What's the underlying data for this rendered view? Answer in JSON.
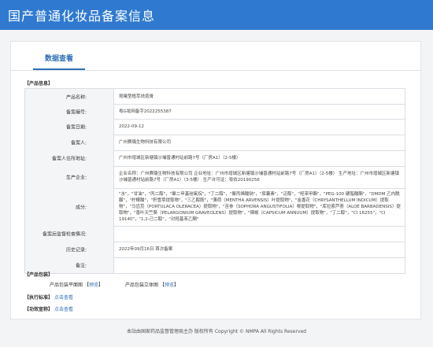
{
  "header": {
    "title": "国产普通化妆品备案信息"
  },
  "tabs": [
    {
      "label": "数据查看"
    }
  ],
  "product_info": {
    "section_title": "【产品信息】",
    "rows": [
      {
        "label": "产品名称:",
        "value": "昆曦莹植萃祛痘膏"
      },
      {
        "label": "备案编号:",
        "value": "粤G妆网备字2022255387"
      },
      {
        "label": "备案日期:",
        "value": "2022-09-12"
      },
      {
        "label": "备案人:",
        "value": "广州赛璐生物科技有限公司"
      },
      {
        "label": "备案人住所地址:",
        "value": "广州市增城区新塘镇沙埔普通村站前路7号（厂房A1）（2-5楼）"
      },
      {
        "label": "生产企业:",
        "value": "企业名称：广州赛璐生物科技有限公司 企业地址：广州市增城区新塘镇沙埔普通村站前路7号（厂房A1）（2-5楼） 生产地址：广州市增城区新塘镇沙埔普通村站前路7号（厂房A1）（3-5楼） 生产许可证：粤妆20190256"
      },
      {
        "label": "成分:",
        "value": "\"水\"，\"甘油\"，\"丙二醇\"，\"聚二甲基硅氧烷\"，\"丁二醇\"，\"聚丙烯酸钠\"，\"尿囊素\"，\"泛醇\"，\"羟苯甲酯\"，\"PEG-100 硬脂酸酯\"，\"DMDM 乙内酰脲\"，\"柠檬酸\"，\"积雪草提取物\"，\"三乙醇胺\"，\"薄荷（MENTHA ARVENSIS）叶提取物\"，\"金盏花（CHRYSANTHELLUM INDICUM）提取物\"，\"马齿苋（PORTULACA OLERACEA）提取物\"，\"苦参（SOPHORA ANGUSTIFOLIA）根提取物\"，\"库拉索芦荟（ALOE BARBADENSIS）提取物\"，\"香叶天竺葵（PELARGONIUM GRAVEOLENS）提取物\"，\"辣椒（CAPSICUM ANNUUM）提取物\"，\"丁二醇\"，\"CI 16255\"，\"CI 19140\"，\"1,2-己二醇\"，\"对羟基苯乙酮\""
      },
      {
        "label": "备案后监督检查情况:",
        "value": ""
      },
      {
        "label": "历史记录:",
        "value": "2022年09月16日 首次备案"
      },
      {
        "label": "备注:",
        "value": ""
      }
    ]
  },
  "packaging": {
    "section_title": "【产品包装】",
    "items": [
      {
        "label": "产品包装平面图",
        "link": "预览"
      },
      {
        "label": "产品包装立体图",
        "link": "预览"
      }
    ]
  },
  "standard": {
    "section_title": "【执行标准】",
    "link": "点击查看"
  },
  "efficacy": {
    "section_title": "【功效宣称】",
    "link": "点击查看"
  },
  "footer": {
    "text": "本站由国家药品监督管理局主办 版权所有 Copyright © NMPA All Rights Reserved"
  }
}
